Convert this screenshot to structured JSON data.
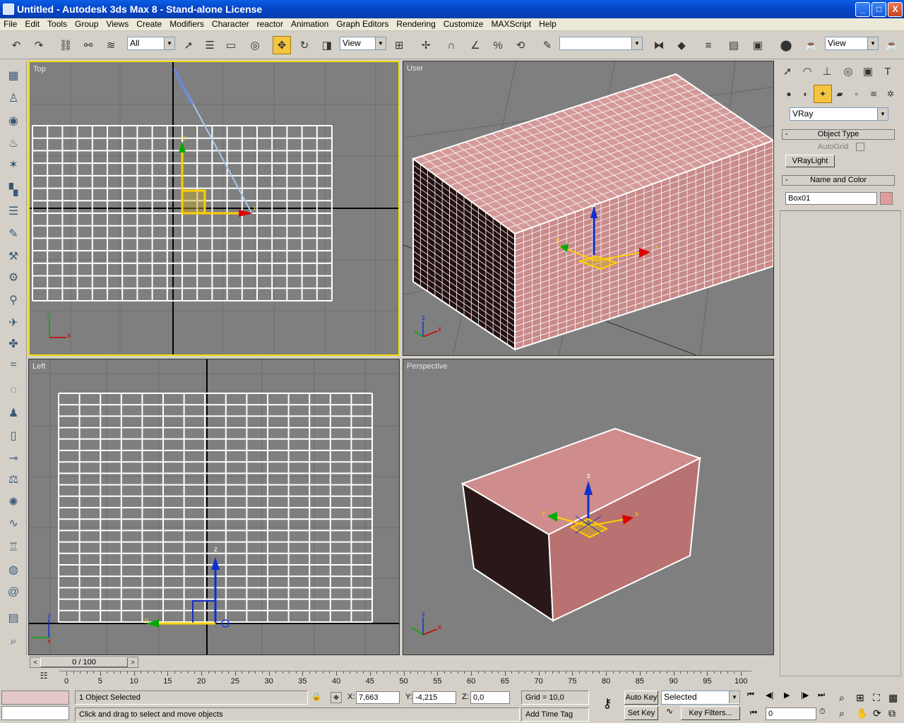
{
  "window": {
    "title": "Untitled - Autodesk 3ds Max 8  - Stand-alone License",
    "minimize": "_",
    "maximize": "□",
    "close": "X"
  },
  "menu": [
    "File",
    "Edit",
    "Tools",
    "Group",
    "Views",
    "Create",
    "Modifiers",
    "Character",
    "reactor",
    "Animation",
    "Graph Editors",
    "Rendering",
    "Customize",
    "MAXScript",
    "Help"
  ],
  "toolbar": {
    "selection_filter": "All",
    "ref_coord": "View",
    "named_selection": "",
    "render_type": "View"
  },
  "viewports": [
    {
      "label": "Top",
      "active": true
    },
    {
      "label": "User",
      "active": false
    },
    {
      "label": "Left",
      "active": false
    },
    {
      "label": "Perspective",
      "active": false
    }
  ],
  "command_panel": {
    "category": "VRay",
    "object_type_title": "Object Type",
    "autogrid_label": "AutoGrid",
    "vraylight_button": "VRayLight",
    "name_color_title": "Name and Color",
    "object_name": "Box01",
    "object_color": "#e39c9c"
  },
  "trackbar": {
    "time_slider": "0 / 100",
    "ticks": [
      "0",
      "5",
      "10",
      "15",
      "20",
      "25",
      "30",
      "35",
      "40",
      "45",
      "50",
      "55",
      "60",
      "65",
      "70",
      "75",
      "80",
      "85",
      "90",
      "95",
      "100"
    ]
  },
  "status": {
    "selected": "1 Object Selected",
    "prompt": "Click and drag to select and move objects",
    "x_label": "X:",
    "x": "7,663",
    "y_label": "Y:",
    "y": "-4,215",
    "z_label": "Z:",
    "z": "0,0",
    "grid": "Grid = 10,0",
    "add_time_tag": "Add Time Tag",
    "auto_key": "Auto Key",
    "set_key": "Set Key",
    "key_mode": "Selected",
    "key_filters": "Key Filters...",
    "current_frame": "0"
  },
  "axis": {
    "x": "x",
    "y": "y",
    "z": "z"
  },
  "colors": {
    "viewport_bg": "#7f7f7f",
    "active_border": "#f0e000",
    "box_face": "#e39c9c",
    "box_dark": "#3a2222",
    "accent_blue": "#0a5ee6"
  }
}
